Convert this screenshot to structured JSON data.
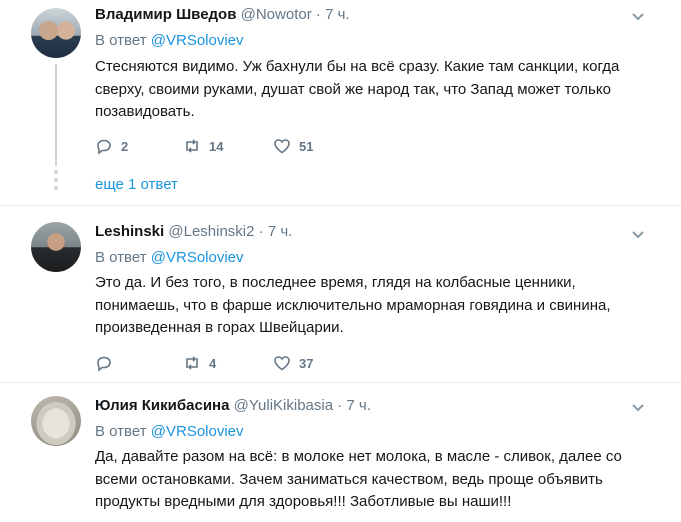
{
  "tweets": [
    {
      "name": "Владимир Шведов",
      "handle": "@Nowotor",
      "dot": "·",
      "time": "7 ч.",
      "reply_prefix": "В ответ",
      "reply_mention": "@VRSoloviev",
      "text": "Стесняются видимо. Уж бахнули бы на всё сразу. Какие там санкции, когда сверху, своими руками, душат свой же народ так, что Запад может только позавидовать.",
      "replies": "2",
      "retweets": "14",
      "likes": "51",
      "more_replies": "еще 1 ответ"
    },
    {
      "name": "Leshinski",
      "handle": "@Leshinski2",
      "dot": "·",
      "time": "7 ч.",
      "reply_prefix": "В ответ",
      "reply_mention": "@VRSoloviev",
      "text": "Это да. И без того, в последнее время, глядя на колбасные ценники, понимаешь, что в фарше исключительно мраморная говядина и свинина, произведенная в горах Швейцарии.",
      "replies": "",
      "retweets": "4",
      "likes": "37"
    },
    {
      "name": "Юлия Кикибасина",
      "handle": "@YuliKikibasia",
      "dot": "·",
      "time": "7 ч.",
      "reply_prefix": "В ответ",
      "reply_mention": "@VRSoloviev",
      "text": "Да, давайте разом на всё: в молоке нет молока, в масле - сливок, далее со всеми остановками. Зачем заниматься качеством, ведь проще объявить продукты вредными для здоровья!!! Заботливые вы наши!!!"
    }
  ],
  "icons": {
    "reply": "reply-icon",
    "retweet": "retweet-icon",
    "like": "heart-icon",
    "caret": "chevron-down-icon"
  }
}
